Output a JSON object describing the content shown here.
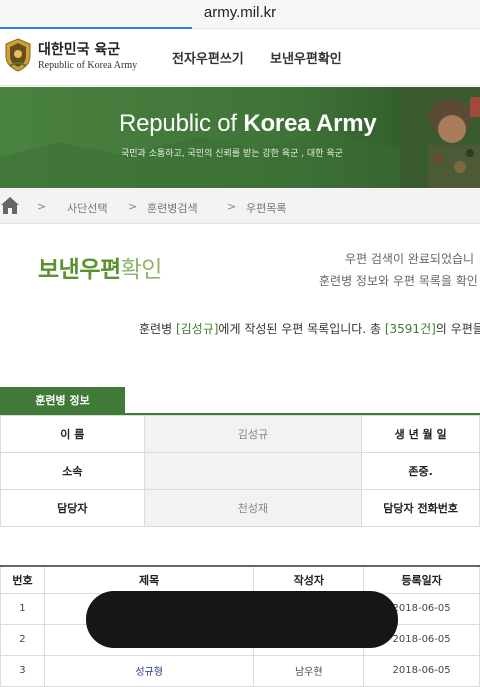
{
  "browser": {
    "url": "army.mil.kr"
  },
  "header": {
    "logo_ko": "대한민국 육군",
    "logo_en": "Republic of Korea Army",
    "nav": {
      "write": "전자우편쓰기",
      "check": "보낸우편확인"
    }
  },
  "banner": {
    "title_part1": "Republic of ",
    "title_part2": "Korea Army",
    "subtitle": "국민과 소통하고, 국민의 신뢰를 받는 강한 육군 , 대한 육군"
  },
  "breadcrumb": {
    "sep": ">",
    "items": [
      "사단선택",
      "훈련병검색",
      "우편목록"
    ]
  },
  "page": {
    "title_bold": "보낸우편",
    "title_light": "확인",
    "notice_line1": "우편 검색이 완료되었습니",
    "notice_line2": "훈련병 정보와 우편 목록을 확인"
  },
  "summary": {
    "prefix": "훈련병 ",
    "name": "[김성규]",
    "middle": "에게 작성된 우편 목록입니다. 총 ",
    "count": "[3591건]",
    "suffix": "의 우편들"
  },
  "info": {
    "tab_label": "훈련병 정보",
    "name_label": "이  름",
    "name_value": "김성규",
    "birth_label": "생 년 월 일",
    "unit_label": "소속",
    "unit_extra": "존중.",
    "manager_label": "담당자",
    "manager_value": "천성재",
    "phone_label": "담당자 전화번호"
  },
  "list": {
    "headers": [
      "번호",
      "제목",
      "작성자",
      "등록일자"
    ],
    "rows": [
      {
        "no": "1",
        "title": "",
        "writer": "",
        "date": "2018-06-05"
      },
      {
        "no": "2",
        "title": "",
        "writer": "",
        "date": "2018-06-05"
      },
      {
        "no": "3",
        "title": "성규형",
        "writer": "남우현",
        "date": "2018-06-05"
      }
    ]
  },
  "colors": {
    "army_green": "#3f7a36",
    "title_green": "#5c9130",
    "link_blue": "#2d3a8c"
  }
}
